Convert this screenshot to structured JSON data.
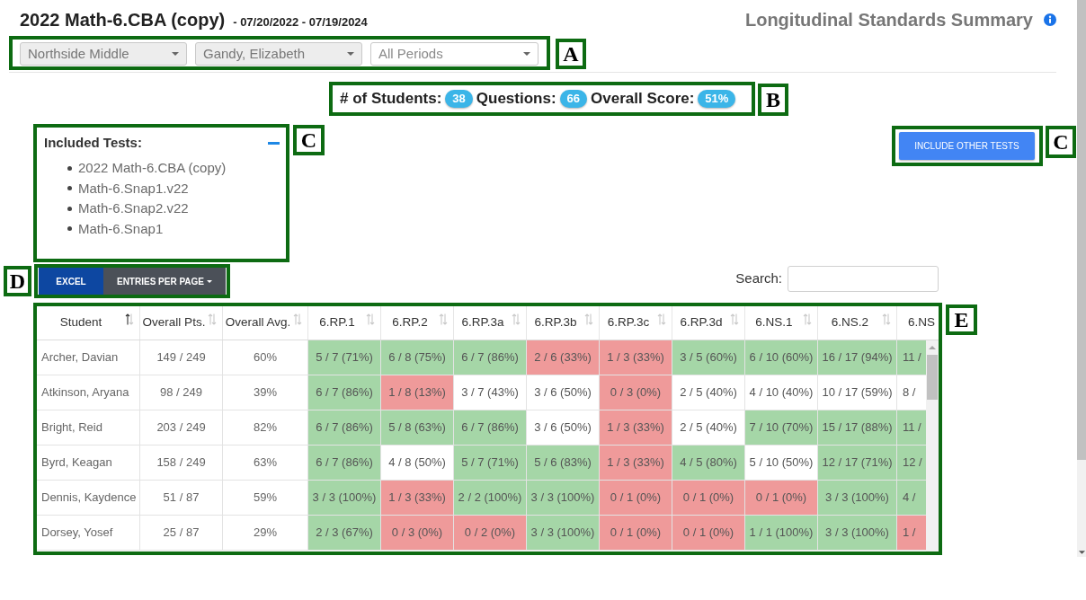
{
  "header": {
    "title": "2022 Math-6.CBA (copy)",
    "date_range": "- 07/20/2022 - 07/19/2024",
    "report_name": "Longitudinal Standards Summary"
  },
  "filters": {
    "annotation": "A",
    "selects": [
      {
        "value": "Northside Middle",
        "disabled": true
      },
      {
        "value": "Gandy, Elizabeth",
        "disabled": true
      },
      {
        "value": "All Periods",
        "disabled": false
      }
    ]
  },
  "summary": {
    "annotation": "B",
    "items": [
      {
        "label": "# of Students:",
        "value": "38"
      },
      {
        "label": "Questions:",
        "value": "66"
      },
      {
        "label": "Overall Score:",
        "value": "51%"
      }
    ]
  },
  "included_tests": {
    "annotation": "C",
    "title": "Included Tests:",
    "expanded": true,
    "items": [
      "2022 Math-6.CBA (copy)",
      "Math-6.Snap1.v22",
      "Math-6.Snap2.v22",
      "Math-6.Snap1"
    ]
  },
  "include_other_tests": {
    "annotation": "C",
    "label": "INCLUDE OTHER TESTS"
  },
  "toolbar": {
    "annotation": "D",
    "buttons": [
      {
        "label": "EXCEL",
        "kind": "export"
      },
      {
        "label": "ENTRIES PER PAGE",
        "kind": "dropdown"
      }
    ]
  },
  "search": {
    "label": "Search:"
  },
  "table": {
    "annotation": "E",
    "columns": [
      {
        "label": "Student",
        "sorted": true
      },
      {
        "label": "Overall Pts.",
        "sorted": false
      },
      {
        "label": "Overall Avg.",
        "sorted": false
      },
      {
        "label": "6.RP.1",
        "sorted": false
      },
      {
        "label": "6.RP.2",
        "sorted": false
      },
      {
        "label": "6.RP.3a",
        "sorted": false
      },
      {
        "label": "6.RP.3b",
        "sorted": false
      },
      {
        "label": "6.RP.3c",
        "sorted": false
      },
      {
        "label": "6.RP.3d",
        "sorted": false
      },
      {
        "label": "6.NS.1",
        "sorted": false
      },
      {
        "label": "6.NS.2",
        "sorted": false
      },
      {
        "label": "6.NS"
      }
    ],
    "rows": [
      {
        "cells": [
          {
            "text": "Archer, Davian"
          },
          {
            "text": "149 / 249"
          },
          {
            "text": "60%"
          },
          {
            "text": "5 / 7 (71%)",
            "color": "#a5d6a7"
          },
          {
            "text": "6 / 8 (75%)",
            "color": "#a5d6a7"
          },
          {
            "text": "6 / 7 (86%)",
            "color": "#a5d6a7"
          },
          {
            "text": "2 / 6 (33%)",
            "color": "#ef9a9a"
          },
          {
            "text": "1 / 3 (33%)",
            "color": "#ef9a9a"
          },
          {
            "text": "3 / 5 (60%)",
            "color": "#a5d6a7"
          },
          {
            "text": "6 / 10 (60%)",
            "color": "#a5d6a7"
          },
          {
            "text": "16 / 17 (94%)",
            "color": "#a5d6a7"
          },
          {
            "text": "11 /",
            "color": "#a5d6a7"
          }
        ]
      },
      {
        "cells": [
          {
            "text": "Atkinson, Aryana"
          },
          {
            "text": "98 / 249"
          },
          {
            "text": "39%"
          },
          {
            "text": "6 / 7 (86%)",
            "color": "#a5d6a7"
          },
          {
            "text": "1 / 8 (13%)",
            "color": "#ef9a9a"
          },
          {
            "text": "3 / 7 (43%)",
            "color": "#ffffff"
          },
          {
            "text": "3 / 6 (50%)",
            "color": "#ffffff"
          },
          {
            "text": "0 / 3 (0%)",
            "color": "#ef9a9a"
          },
          {
            "text": "2 / 5 (40%)",
            "color": "#ffffff"
          },
          {
            "text": "4 / 10 (40%)",
            "color": "#ffffff"
          },
          {
            "text": "10 / 17 (59%)",
            "color": "#ffffff"
          },
          {
            "text": "8 /",
            "color": "#ffffff"
          }
        ]
      },
      {
        "cells": [
          {
            "text": "Bright, Reid"
          },
          {
            "text": "203 / 249"
          },
          {
            "text": "82%"
          },
          {
            "text": "6 / 7 (86%)",
            "color": "#a5d6a7"
          },
          {
            "text": "5 / 8 (63%)",
            "color": "#a5d6a7"
          },
          {
            "text": "6 / 7 (86%)",
            "color": "#a5d6a7"
          },
          {
            "text": "3 / 6 (50%)",
            "color": "#ffffff"
          },
          {
            "text": "1 / 3 (33%)",
            "color": "#ef9a9a"
          },
          {
            "text": "2 / 5 (40%)",
            "color": "#ffffff"
          },
          {
            "text": "7 / 10 (70%)",
            "color": "#a5d6a7"
          },
          {
            "text": "15 / 17 (88%)",
            "color": "#a5d6a7"
          },
          {
            "text": "11 /",
            "color": "#a5d6a7"
          }
        ]
      },
      {
        "cells": [
          {
            "text": "Byrd, Keagan"
          },
          {
            "text": "158 / 249"
          },
          {
            "text": "63%"
          },
          {
            "text": "6 / 7 (86%)",
            "color": "#a5d6a7"
          },
          {
            "text": "4 / 8 (50%)",
            "color": "#ffffff"
          },
          {
            "text": "5 / 7 (71%)",
            "color": "#a5d6a7"
          },
          {
            "text": "5 / 6 (83%)",
            "color": "#a5d6a7"
          },
          {
            "text": "1 / 3 (33%)",
            "color": "#ef9a9a"
          },
          {
            "text": "4 / 5 (80%)",
            "color": "#a5d6a7"
          },
          {
            "text": "5 / 10 (50%)",
            "color": "#ffffff"
          },
          {
            "text": "12 / 17 (71%)",
            "color": "#a5d6a7"
          },
          {
            "text": "12 /",
            "color": "#a5d6a7"
          }
        ]
      },
      {
        "cells": [
          {
            "text": "Dennis, Kaydence"
          },
          {
            "text": "51 / 87"
          },
          {
            "text": "59%"
          },
          {
            "text": "3 / 3 (100%)",
            "color": "#a5d6a7"
          },
          {
            "text": "1 / 3 (33%)",
            "color": "#ef9a9a"
          },
          {
            "text": "2 / 2 (100%)",
            "color": "#a5d6a7"
          },
          {
            "text": "3 / 3 (100%)",
            "color": "#a5d6a7"
          },
          {
            "text": "0 / 1 (0%)",
            "color": "#ef9a9a"
          },
          {
            "text": "0 / 1 (0%)",
            "color": "#ef9a9a"
          },
          {
            "text": "0 / 1 (0%)",
            "color": "#ef9a9a"
          },
          {
            "text": "3 / 3 (100%)",
            "color": "#a5d6a7"
          },
          {
            "text": "4 /",
            "color": "#a5d6a7"
          }
        ]
      },
      {
        "cells": [
          {
            "text": "Dorsey, Yosef"
          },
          {
            "text": "25 / 87"
          },
          {
            "text": "29%"
          },
          {
            "text": "2 / 3 (67%)",
            "color": "#a5d6a7"
          },
          {
            "text": "0 / 3 (0%)",
            "color": "#ef9a9a"
          },
          {
            "text": "0 / 2 (0%)",
            "color": "#ef9a9a"
          },
          {
            "text": "3 / 3 (100%)",
            "color": "#a5d6a7"
          },
          {
            "text": "0 / 1 (0%)",
            "color": "#ef9a9a"
          },
          {
            "text": "0 / 1 (0%)",
            "color": "#ef9a9a"
          },
          {
            "text": "1 / 1 (100%)",
            "color": "#a5d6a7"
          },
          {
            "text": "3 / 3 (100%)",
            "color": "#a5d6a7"
          },
          {
            "text": "1 /",
            "color": "#ef9a9a"
          }
        ]
      }
    ]
  }
}
